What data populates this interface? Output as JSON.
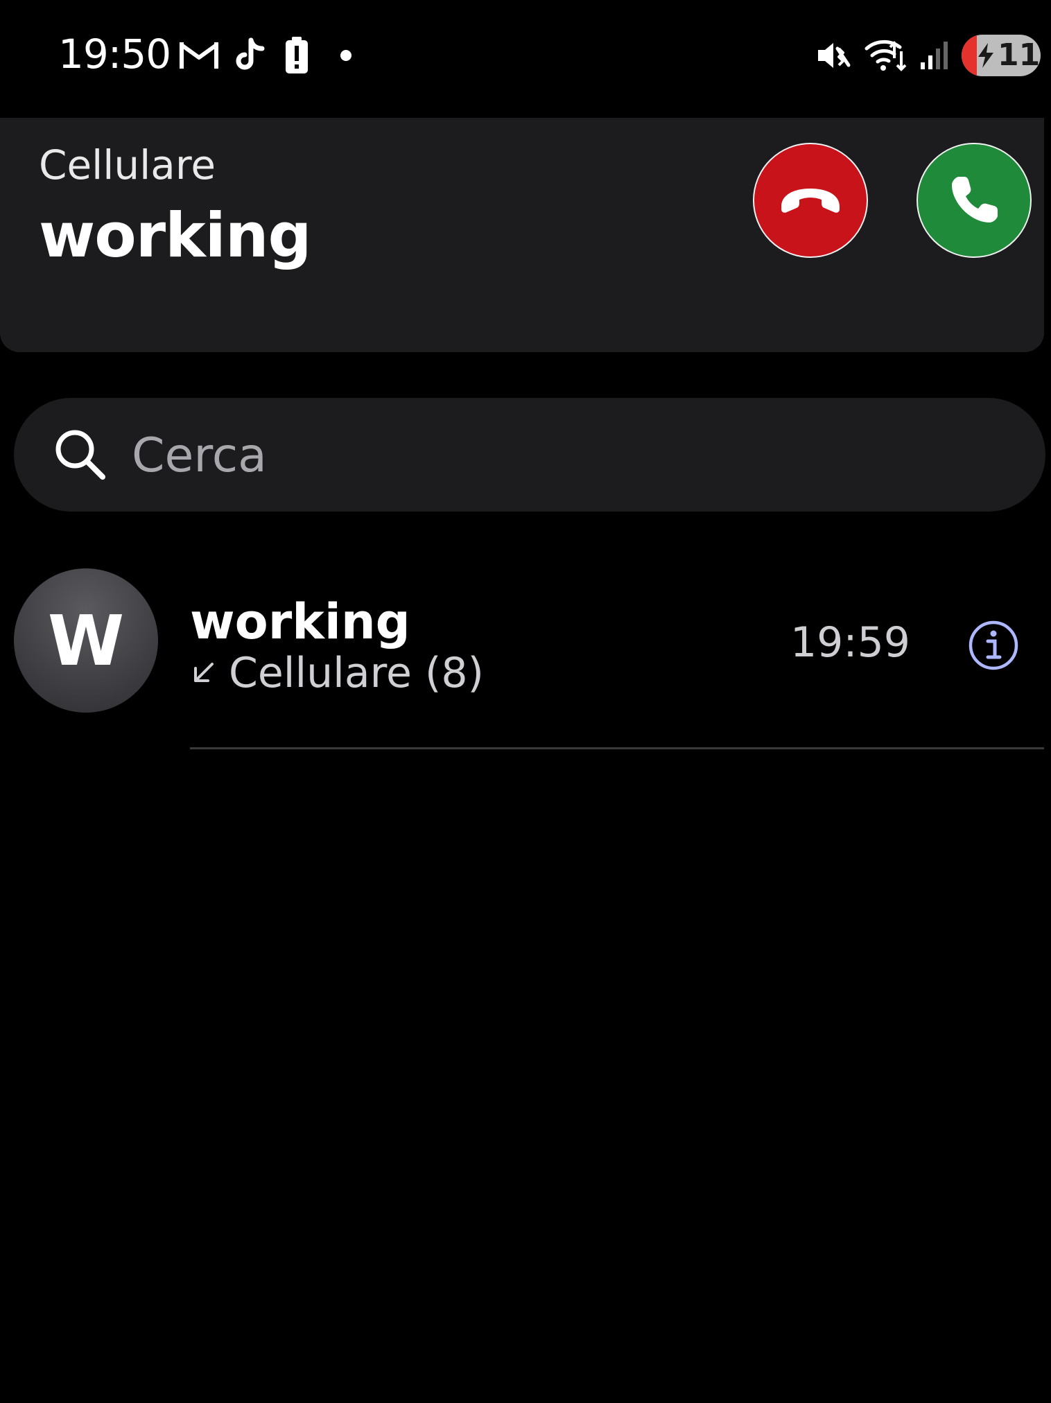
{
  "status_bar": {
    "time": "19:50",
    "battery_level": "11",
    "notification_icons": [
      "gmail-icon",
      "tiktok-icon",
      "battery-alert-icon",
      "dot-icon"
    ],
    "system_icons": [
      "mute-icon",
      "wifi-icon",
      "signal-icon",
      "battery-charging-icon"
    ]
  },
  "incoming_call": {
    "line_type": "Cellulare",
    "caller_name": "working",
    "decline_icon": "phone-hangup-icon",
    "accept_icon": "phone-icon",
    "decline_color": "#c8131b",
    "accept_color": "#1f8a3a"
  },
  "search": {
    "placeholder": "Cerca",
    "icon": "search-icon"
  },
  "recents": [
    {
      "avatar_letter": "W",
      "name": "working",
      "call_direction_icon": "incoming-arrow-icon",
      "detail": "Cellulare (8)",
      "time": "19:59",
      "info_icon": "info-icon"
    }
  ],
  "colors": {
    "background": "#000000",
    "card": "#1c1c1e",
    "info_accent": "#aeb8ff"
  }
}
